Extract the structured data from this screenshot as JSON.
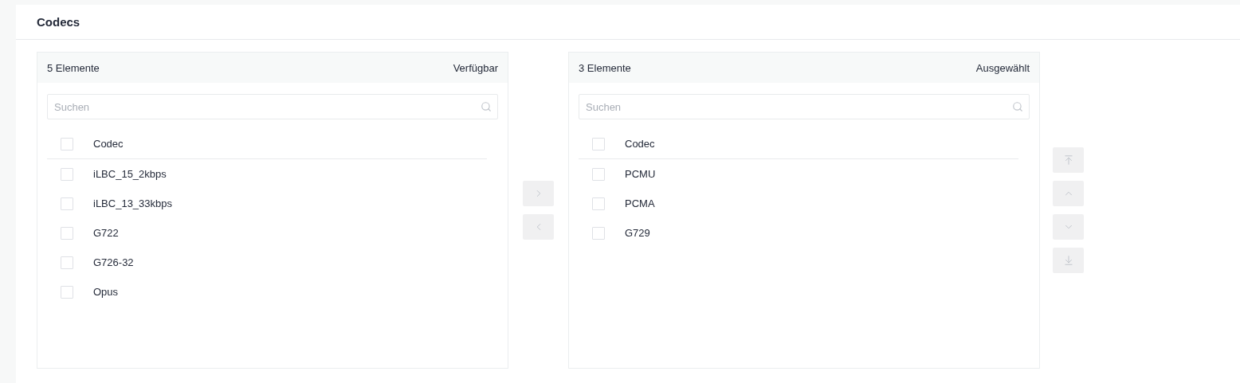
{
  "section": {
    "title": "Codecs"
  },
  "available": {
    "count": "5 Elemente",
    "title": "Verfügbar",
    "search": {
      "placeholder": "Suchen"
    },
    "column": "Codec",
    "header_checked": false,
    "items": [
      {
        "label": "iLBC_15_2kbps",
        "checked": false
      },
      {
        "label": "iLBC_13_33kbps",
        "checked": false
      },
      {
        "label": "G722",
        "checked": false
      },
      {
        "label": "G726-32",
        "checked": false
      },
      {
        "label": "Opus",
        "checked": false
      }
    ]
  },
  "transfer_buttons": [
    {
      "kind": "right",
      "disabled": true
    },
    {
      "kind": "left",
      "disabled": true
    }
  ],
  "selected": {
    "count": "3 Elemente",
    "title": "Ausgewählt",
    "search": {
      "placeholder": "Suchen"
    },
    "column": "Codec",
    "header_checked": false,
    "items": [
      {
        "label": "PCMU",
        "checked": false
      },
      {
        "label": "PCMA",
        "checked": false
      },
      {
        "label": "G729",
        "checked": false
      }
    ]
  },
  "sort_buttons": [
    {
      "kind": "top",
      "disabled": true
    },
    {
      "kind": "up",
      "disabled": true
    },
    {
      "kind": "down",
      "disabled": true
    },
    {
      "kind": "bottom",
      "disabled": true
    }
  ]
}
